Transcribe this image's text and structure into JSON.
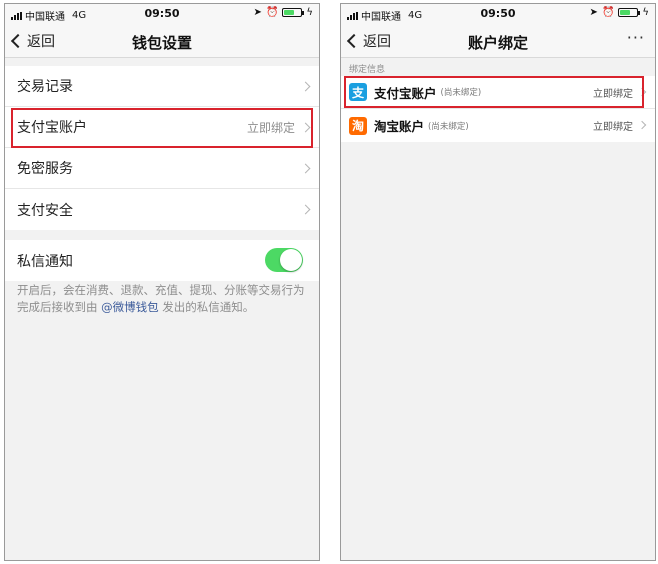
{
  "status_bar": {
    "carrier": "中国联通",
    "network": "4G",
    "time": "09:50"
  },
  "left_screen": {
    "nav": {
      "back_label": "返回",
      "title": "钱包设置"
    },
    "group1": [
      {
        "label": "交易记录",
        "value": ""
      },
      {
        "label": "支付宝账户",
        "value": "立即绑定"
      },
      {
        "label": "免密服务",
        "value": ""
      },
      {
        "label": "支付安全",
        "value": ""
      }
    ],
    "notification": {
      "label": "私信通知",
      "enabled": true
    },
    "note": {
      "prefix": "开启后，会在消费、退款、充值、提现、分账等交易行为完成后接收到由 ",
      "link": "@微博钱包",
      "suffix": " 发出的私信通知。"
    }
  },
  "right_screen": {
    "nav": {
      "back_label": "返回",
      "title": "账户绑定",
      "more_label": "···"
    },
    "section_header": "绑定信息",
    "accounts": [
      {
        "icon": "支",
        "icon_color": "#1a9fe0",
        "name": "支付宝账户",
        "status": "(尚未绑定)",
        "action": "立即绑定"
      },
      {
        "icon": "淘",
        "icon_color": "#ff6a00",
        "name": "淘宝账户",
        "status": "(尚未绑定)",
        "action": "立即绑定"
      }
    ]
  },
  "colors": {
    "toggle_on": "#4cd964",
    "highlight": "#d9232d",
    "link": "#3c5b9a"
  }
}
